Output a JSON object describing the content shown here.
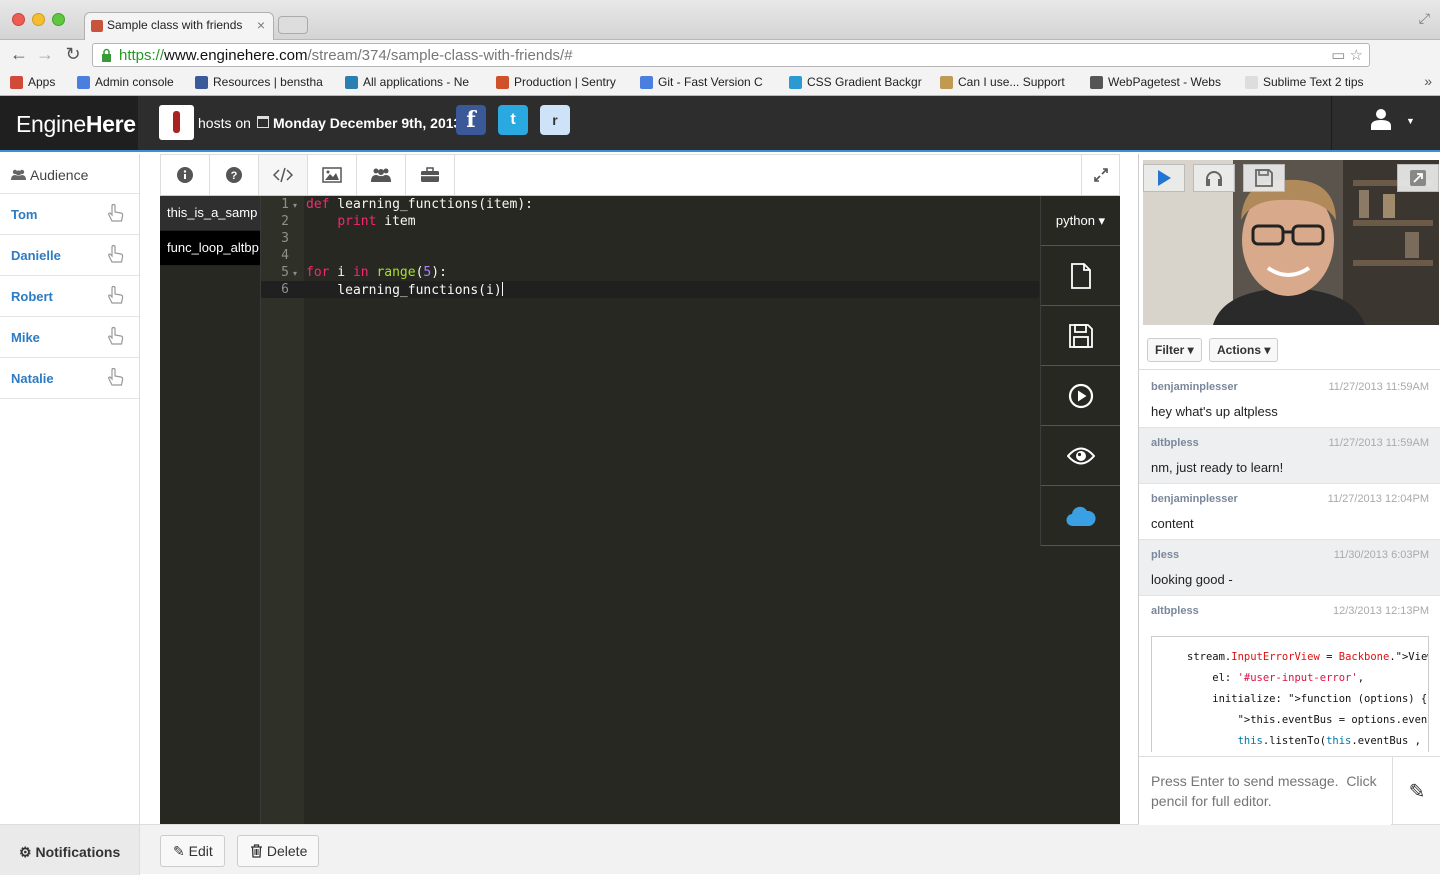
{
  "browser": {
    "tab_title": "Sample class with friends",
    "tab_close": "×",
    "url_scheme": "https://",
    "url_host": "www.enginehere.com",
    "url_path": "/stream/374/sample-class-with-friends/#",
    "bookmarks": [
      {
        "label": "Apps",
        "color": "#d04a3a"
      },
      {
        "label": "Admin console",
        "color": "#4a7fe0"
      },
      {
        "label": "Resources | benstha",
        "color": "#3a5a9a"
      },
      {
        "label": "All applications - Ne",
        "color": "#2a7fb0"
      },
      {
        "label": "Production | Sentry",
        "color": "#d0502a"
      },
      {
        "label": "Git - Fast Version C",
        "color": "#4a7fe0"
      },
      {
        "label": "CSS Gradient Backgr",
        "color": "#2a9ad0"
      },
      {
        "label": "Can I use... Support",
        "color": "#c09a50"
      },
      {
        "label": "WebPagetest - Webs",
        "color": "#555555"
      },
      {
        "label": "Sublime Text 2 tips",
        "color": "#dddddd"
      }
    ],
    "bookmarks_more": "»"
  },
  "app": {
    "brand_light": "Engine",
    "brand_bold": "Here",
    "hosts_on": "hosts on",
    "host_date": "Monday December 9th, 2013",
    "social": {
      "facebook": "f",
      "twitter": "t",
      "reddit": "r"
    },
    "accent": "#3b8fd6"
  },
  "audience": {
    "title": "Audience",
    "members": [
      "Tom",
      "Danielle",
      "Robert",
      "Mike",
      "Natalie"
    ]
  },
  "editor": {
    "files": [
      "this_is_a_samp",
      "func_loop_altbp"
    ],
    "active_file": 1,
    "language": "python ▾",
    "line_numbers": [
      "1",
      "2",
      "3",
      "4",
      "5",
      "6"
    ],
    "code_lines": [
      "def learning_functions(item):",
      "    print item",
      "",
      "",
      "for i in range(5):",
      "    learning_functions(i)"
    ]
  },
  "bottom": {
    "notifications": "Notifications",
    "edit": "Edit",
    "delete": "Delete"
  },
  "chat": {
    "filter": "Filter ▾",
    "actions": "Actions ▾",
    "messages": [
      {
        "user": "benjaminplesser",
        "time": "11/27/2013 11:59AM",
        "text": "hey what's up altpless"
      },
      {
        "user": "altbpless",
        "time": "11/27/2013 11:59AM",
        "text": "nm, just ready to learn!"
      },
      {
        "user": "benjaminplesser",
        "time": "11/27/2013 12:04PM",
        "text": "content"
      },
      {
        "user": "pless",
        "time": "11/30/2013 6:03PM",
        "text": "looking good -"
      },
      {
        "user": "altbpless",
        "time": "12/3/2013 12:13PM",
        "text": ""
      }
    ],
    "code_snippet": [
      "stream.InputErrorView = Backbone.View.ext",
      "    el: '#user-input-error',",
      "    initialize: function (options) {",
      "        this.eventBus = options.eventBus",
      "        this.listenTo(this.eventBus , \"in"
    ],
    "input_placeholder": "Press Enter to send message.  Click pencil for full editor.",
    "pencil": "✎"
  }
}
